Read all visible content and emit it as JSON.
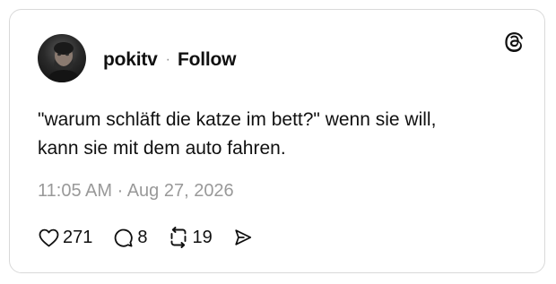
{
  "post": {
    "author": {
      "username": "pokitv",
      "separator": "·",
      "follow_label": "Follow"
    },
    "text": "\"warum schläft die katze im bett?\" wenn sie will,\nkann sie mit dem auto fahren.",
    "timestamp": "11:05 AM · Aug 27, 2026",
    "stats": {
      "likes": "271",
      "replies": "8",
      "reposts": "19"
    }
  },
  "icons": {
    "brand": "threads-logo-icon",
    "like": "heart-icon",
    "reply": "comment-bubble-icon",
    "repost": "repost-icon",
    "share": "send-icon"
  },
  "colors": {
    "text": "#101010",
    "muted": "#999999",
    "border": "#d9d9d9"
  }
}
